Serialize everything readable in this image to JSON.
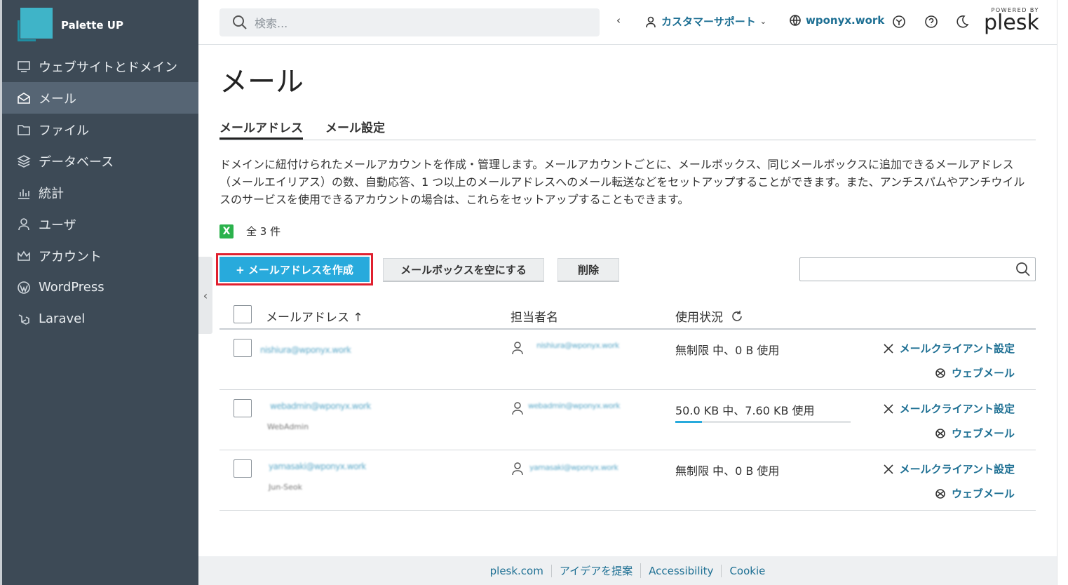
{
  "sidebar": {
    "brand": "Palette UP",
    "items": [
      {
        "label": "ウェブサイトとドメイン",
        "icon": "monitor-icon"
      },
      {
        "label": "メール",
        "icon": "mail-icon",
        "active": true
      },
      {
        "label": "ファイル",
        "icon": "folder-icon"
      },
      {
        "label": "データベース",
        "icon": "database-icon"
      },
      {
        "label": "統計",
        "icon": "chart-icon"
      },
      {
        "label": "ユーザ",
        "icon": "user-icon"
      },
      {
        "label": "アカウント",
        "icon": "crown-icon"
      },
      {
        "label": "WordPress",
        "icon": "wordpress-icon"
      },
      {
        "label": "Laravel",
        "icon": "laravel-icon"
      }
    ]
  },
  "header": {
    "search_placeholder": "検索...",
    "support": "カスタマーサポート",
    "domain": "wponyx.work",
    "powered_by": "POWERED BY",
    "plesk": "plesk"
  },
  "main": {
    "title": "メール",
    "tabs": [
      "メールアドレス",
      "メール設定"
    ],
    "description": "ドメインに紐付けられたメールアカウントを作成・管理します。メールアカウントごとに、メールボックス、同じメールボックスに追加できるメールアドレス（メールエイリアス）の数、自動応答、1 つ以上のメールアドレスへのメール転送などをセットアップすることができます。また、アンチスパムやアンチウイルスのサービスを使用できるアカウントの場合は、これらをセットアップすることもできます。",
    "count": "全 3 件",
    "create_button": "+ メールアドレスを作成",
    "empty_button": "メールボックスを空にする",
    "delete_button": "削除",
    "columns": {
      "email": "メールアドレス ↑",
      "owner": "担当者名",
      "usage": "使用状況"
    },
    "rows": [
      {
        "email": "nishiura@wponyx.work",
        "sub": "",
        "owner": "nishiura@wponyx.work",
        "usage": "無制限 中、0 B 使用",
        "bar_fraction": null
      },
      {
        "email": "webadmin@wponyx.work",
        "sub": "WebAdmin",
        "owner": "webadmin@wponyx.work",
        "usage": "50.0 KB 中、7.60 KB 使用",
        "bar_fraction": 0.15
      },
      {
        "email": "yamasaki@wponyx.work",
        "sub": "Jun-Seok",
        "owner": "yamasaki@wponyx.work",
        "usage": "無制限 中、0 B 使用",
        "bar_fraction": null
      }
    ],
    "action_client": "メールクライアント設定",
    "action_webmail": "ウェブメール"
  },
  "footer": {
    "links": [
      "plesk.com",
      "アイデアを提案",
      "Accessibility",
      "Cookie"
    ]
  }
}
